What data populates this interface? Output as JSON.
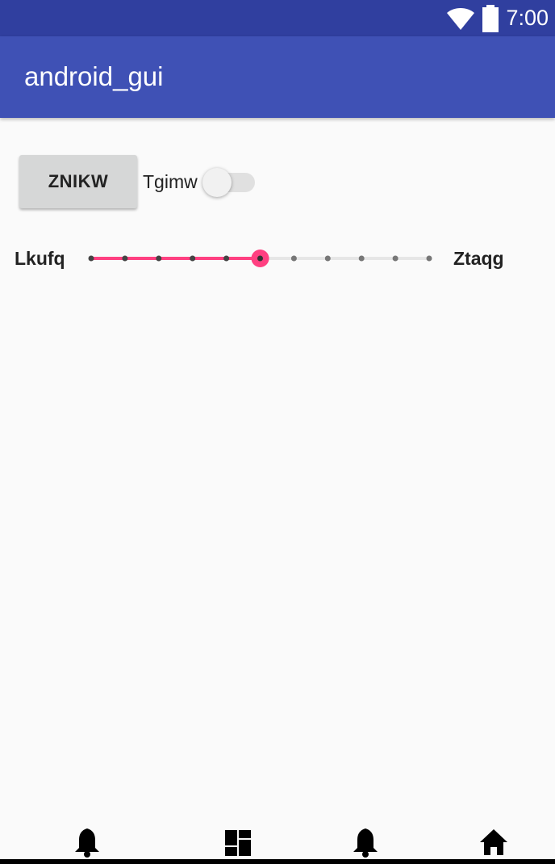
{
  "status_bar": {
    "time": "7:00",
    "icons": [
      "wifi-icon",
      "battery-icon"
    ]
  },
  "app_bar": {
    "title": "android_gui"
  },
  "button": {
    "label": "ZNIKW"
  },
  "switch": {
    "label": "Tgimw",
    "checked": false
  },
  "seekbar": {
    "min_label": "Lkufq",
    "max_label": "Ztaqg",
    "steps": 10,
    "value": 5
  },
  "bottom_nav": {
    "icons": [
      "bell-icon",
      "dashboard-icon",
      "bell-icon",
      "home-icon"
    ]
  },
  "colors": {
    "status_bar": "#303f9f",
    "app_bar": "#3f51b5",
    "accent": "#ff4081",
    "background": "#fafafa"
  }
}
